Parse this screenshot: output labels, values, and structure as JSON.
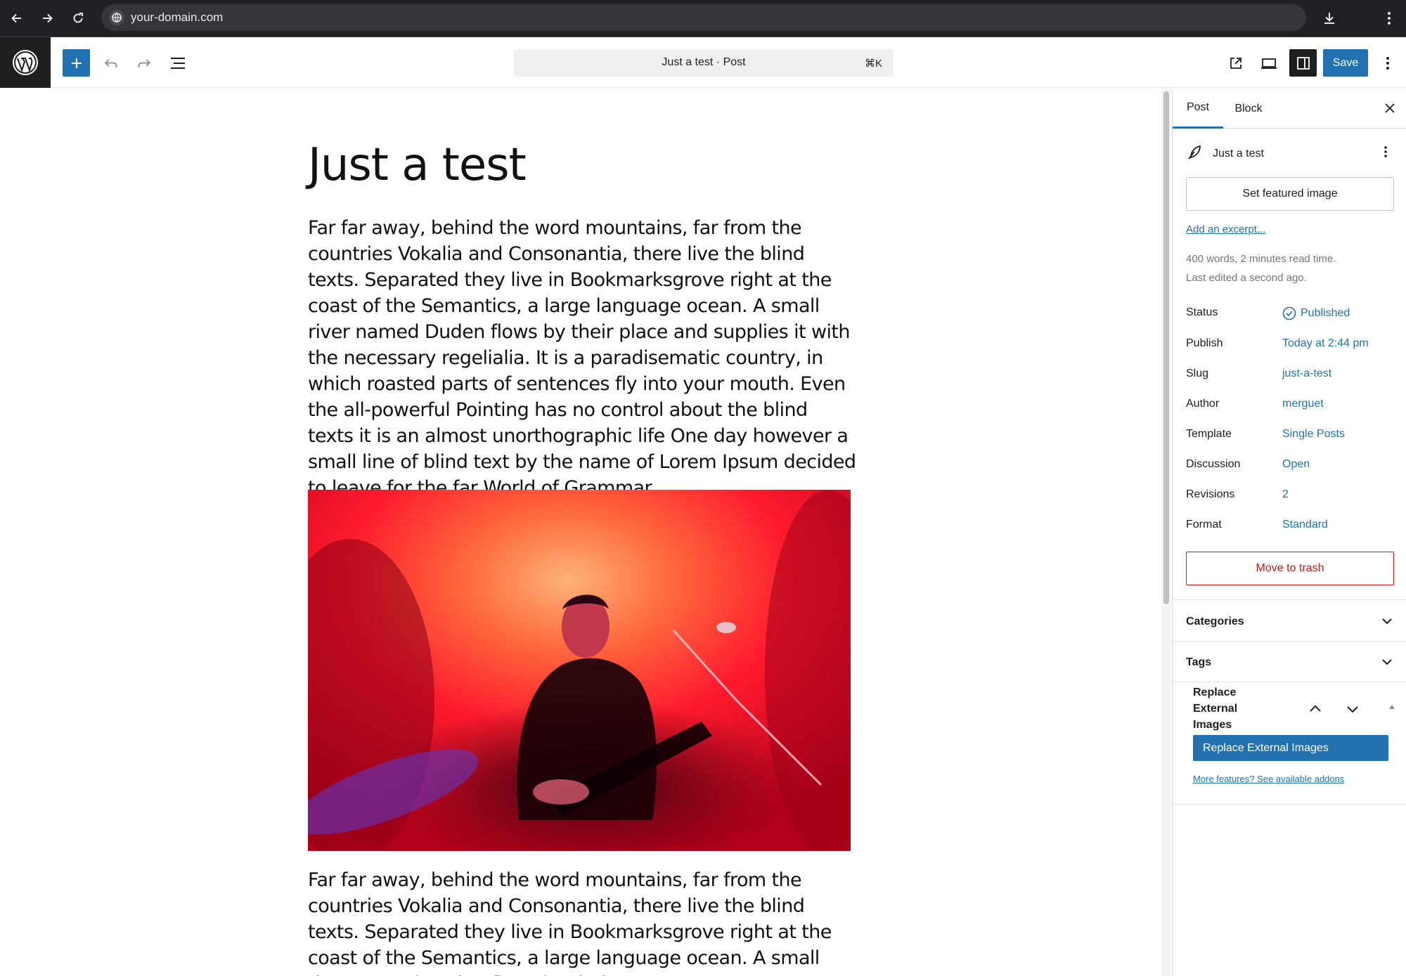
{
  "browser": {
    "url": "your-domain.com"
  },
  "header": {
    "document_title": "Just a test · Post",
    "shortcut": "⌘K",
    "save_label": "Save"
  },
  "post": {
    "title": "Just a test",
    "paragraph1": "Far far away, behind the word mountains, far from the countries Vokalia and Consonantia, there live the blind texts. Separated they live in Bookmarksgrove right at the coast of the Semantics, a large language ocean. A small river named Duden flows by their place and supplies it with the necessary regelialia. It is a paradisematic country, in which roasted parts of sentences fly into your mouth. Even the all-powerful Pointing has no control about the blind texts it is an almost unorthographic life One day however a small line of blind text by the name of Lorem Ipsum decided to leave for the far World of Grammar.",
    "paragraph2": "Far far away, behind the word mountains, far from the countries Vokalia and Consonantia, there live the blind texts. Separated they live in Bookmarksgrove right at the coast of the Semantics, a large language ocean. A small river named Duden flows by their"
  },
  "sidebar": {
    "tabs": [
      {
        "label": "Post"
      },
      {
        "label": "Block"
      }
    ],
    "summary": {
      "title": "Just a test",
      "featured_image_label": "Set featured image",
      "excerpt_link": "Add an excerpt...",
      "word_info": "400 words, 2 minutes read time.",
      "last_edited": "Last edited a second ago."
    },
    "rows": [
      {
        "label": "Status",
        "value": "Published"
      },
      {
        "label": "Publish",
        "value": "Today at 2:44 pm"
      },
      {
        "label": "Slug",
        "value": "just-a-test"
      },
      {
        "label": "Author",
        "value": "merguet"
      },
      {
        "label": "Template",
        "value": "Single Posts"
      },
      {
        "label": "Discussion",
        "value": "Open"
      },
      {
        "label": "Revisions",
        "value": "2"
      },
      {
        "label": "Format",
        "value": "Standard"
      }
    ],
    "trash_label": "Move to trash",
    "panels": {
      "categories": "Categories",
      "tags": "Tags"
    },
    "replace_external": {
      "title": "Replace External Images",
      "button_label": "Replace External Images",
      "link": "More features? See available addons"
    }
  },
  "colors": {
    "accent": "#2271b1",
    "danger": "#cc1818",
    "dark": "#1e1e1e"
  }
}
